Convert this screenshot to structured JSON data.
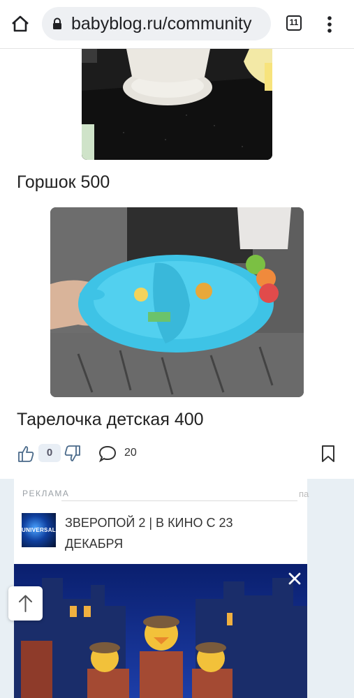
{
  "browser": {
    "url": "babyblog.ru/community",
    "tab_count": "11"
  },
  "post": {
    "caption_1": "Горшок 500",
    "caption_2": "Тарелочка детская 400",
    "likes": "0",
    "comments": "20"
  },
  "ad": {
    "label": "РЕКЛАМА",
    "corner": "па",
    "logo_text": "UNIVERSAL",
    "title": "ЗВЕРОПОЙ 2 | В КИНО С 23 ДЕКАБРЯ"
  },
  "icons": {
    "home": "home-icon",
    "lock": "lock-icon",
    "tabs": "tabs-icon",
    "menu": "more-vert-icon",
    "like": "thumb-up-icon",
    "dislike": "thumb-down-icon",
    "comment": "comment-icon",
    "bookmark": "bookmark-icon",
    "close": "close-icon",
    "scroll_top": "arrow-up-icon"
  },
  "colors": {
    "plate": "#3ec3e6",
    "ad_background": "#e8eff4"
  }
}
